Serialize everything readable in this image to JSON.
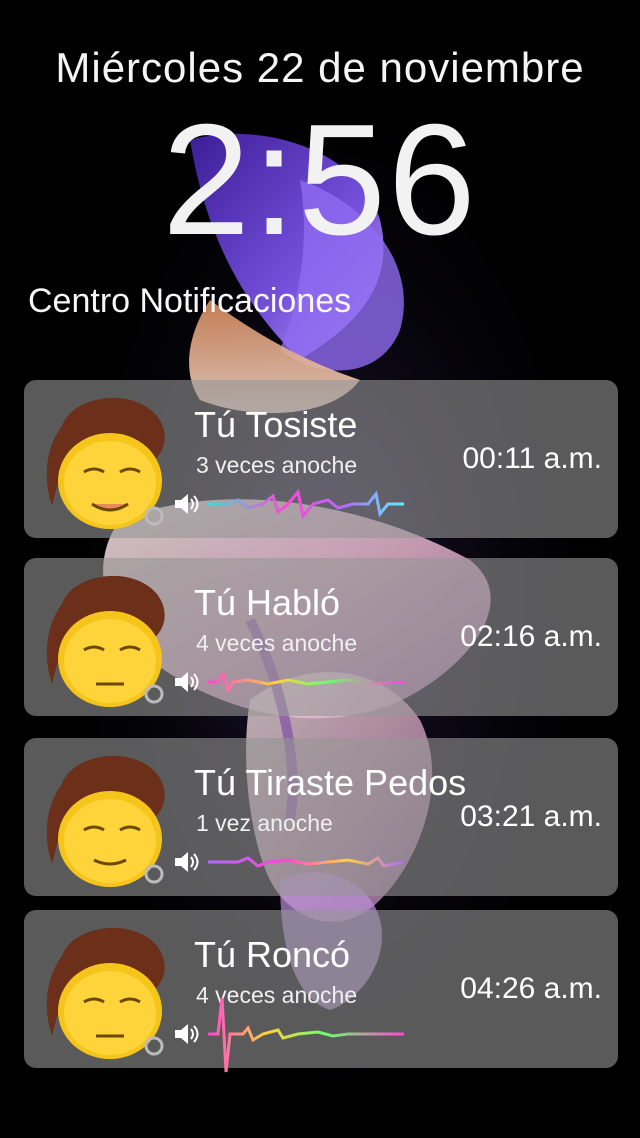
{
  "lockscreen": {
    "date": "Miércoles 22 de noviembre",
    "time": "2:56"
  },
  "notification_center": {
    "title": "Centro Notificaciones",
    "items": [
      {
        "title": "Tú Tosiste",
        "subtitle": "3 veces anoche",
        "time": "00:11 a.m.",
        "icon": "speaker-icon"
      },
      {
        "title": "Tú Habló",
        "subtitle": "4 veces anoche",
        "time": "02:16 a.m.",
        "icon": "speaker-icon"
      },
      {
        "title": "Tú Tiraste Pedos",
        "subtitle": "1 vez anoche",
        "time": "03:21 a.m.",
        "icon": "speaker-icon"
      },
      {
        "title": "Tú Roncó",
        "subtitle": "4 veces anoche",
        "time": "04:26 a.m.",
        "icon": "speaker-icon"
      }
    ]
  },
  "colors": {
    "background": "#000000",
    "card": "#969696",
    "wallpaper_purple": "#6b3fd6",
    "wallpaper_pink": "#e8c6c8"
  }
}
